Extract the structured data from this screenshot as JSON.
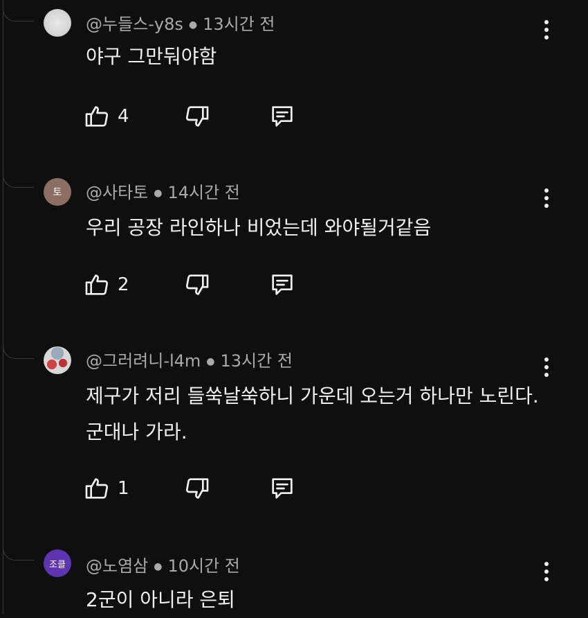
{
  "comments": [
    {
      "avatar_text": "",
      "avatar_color": "#d4d4d4",
      "author": "@누들스-y8s",
      "time": "13시간 전",
      "text": "야구 그만둬야함",
      "likes": "4"
    },
    {
      "avatar_text": "토",
      "avatar_color": "#8d6e63",
      "author": "@사타토",
      "time": "14시간 전",
      "text": "우리 공장 라인하나 비었는데 와야될거같음",
      "likes": "2"
    },
    {
      "avatar_text": "",
      "avatar_color": "#d8d8d8",
      "author": "@그러려니-l4m",
      "time": "13시간 전",
      "text": "제구가 저리 들쑥날쑥하니 가운데 오는거 하나만 노린다. 군대나 가라.",
      "likes": "1"
    },
    {
      "avatar_text": "조클",
      "avatar_color": "#5e35b1",
      "author": "@노염삼",
      "time": "10시간 전",
      "text": "2군이 아니라 은퇴",
      "likes": ""
    }
  ],
  "icons": {
    "like": "thumb-up-icon",
    "dislike": "thumb-down-icon",
    "reply": "reply-comment-icon",
    "more": "more-vert-icon"
  },
  "colors": {
    "background": "#0f0f0f",
    "text": "#f1f1f1",
    "meta": "#aaaaaa",
    "thread": "#3a3a3a"
  }
}
